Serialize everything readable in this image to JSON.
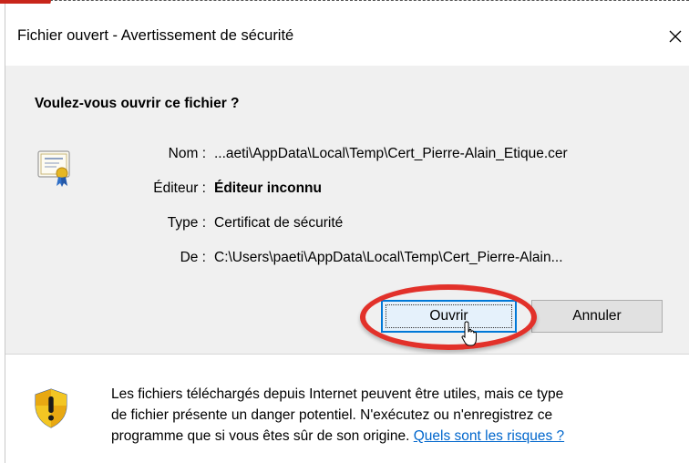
{
  "dialog": {
    "title": "Fichier ouvert - Avertissement de sécurité",
    "close_symbol": "✕",
    "question": "Voulez-vous ouvrir ce fichier ?"
  },
  "details": {
    "name": {
      "label": "Nom :",
      "value": "...aeti\\AppData\\Local\\Temp\\Cert_Pierre-Alain_Etique.cer"
    },
    "publisher": {
      "label": "Éditeur :",
      "value": "Éditeur inconnu"
    },
    "type": {
      "label": "Type :",
      "value": "Certificat de sécurité"
    },
    "from": {
      "label": "De :",
      "value": "C:\\Users\\paeti\\AppData\\Local\\Temp\\Cert_Pierre-Alain..."
    }
  },
  "buttons": {
    "open": "Ouvrir",
    "cancel": "Annuler"
  },
  "warning": {
    "line1": "Les fichiers téléchargés depuis Internet peuvent être utiles, mais ce type",
    "line2": "de fichier présente un danger potentiel. N'exécutez ou n'enregistrez ce",
    "line3": "programme que si vous êtes sûr de son origine.",
    "link": "Quels sont les risques ?"
  },
  "icons": {
    "certificate": "certificate-icon",
    "shield": "security-shield-icon",
    "cursor": "mouse-cursor-icon"
  },
  "colors": {
    "highlight_ellipse": "#e2312a",
    "link": "#0066cc",
    "default_button_border": "#0078d7"
  }
}
